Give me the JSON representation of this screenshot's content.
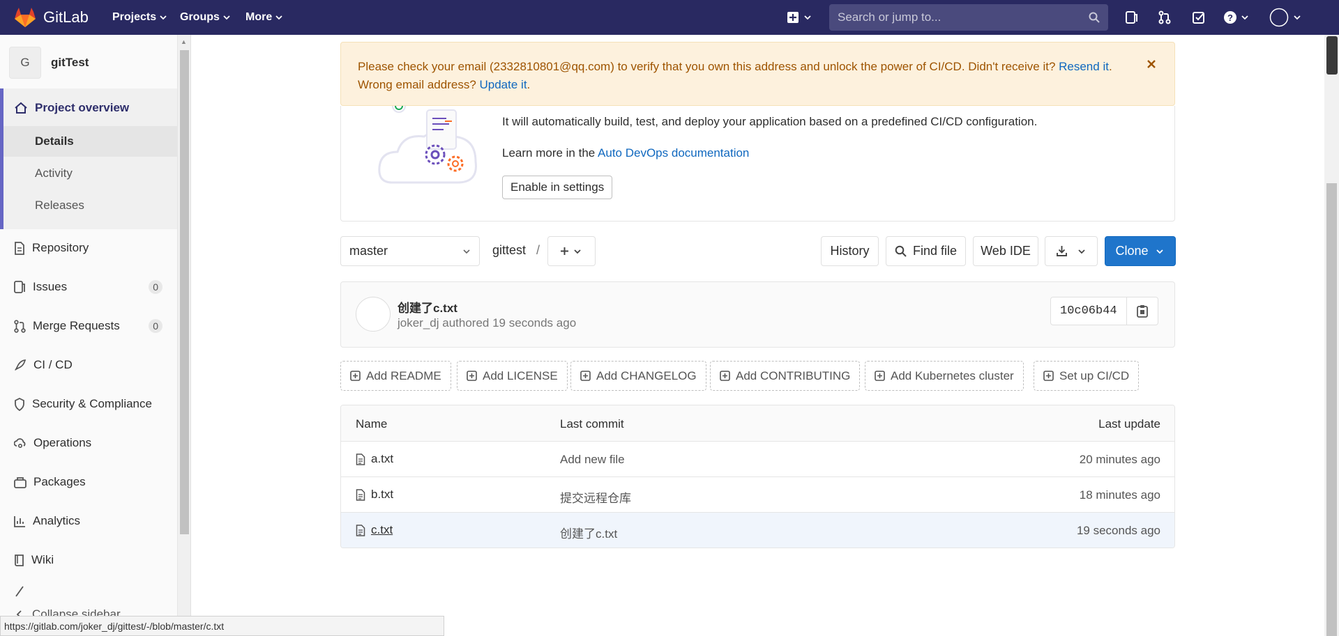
{
  "topnav": {
    "logo_text": "GitLab",
    "menus": [
      "Projects",
      "Groups",
      "More"
    ],
    "search_placeholder": "Search or jump to..."
  },
  "sidebar": {
    "project_initial": "G",
    "project_name": "gitTest",
    "overview_label": "Project overview",
    "overview_items": [
      "Details",
      "Activity",
      "Releases"
    ],
    "items": [
      {
        "label": "Repository",
        "icon": "document-icon"
      },
      {
        "label": "Issues",
        "icon": "issues-icon",
        "count": "0"
      },
      {
        "label": "Merge Requests",
        "icon": "merge-request-icon",
        "count": "0"
      },
      {
        "label": "CI / CD",
        "icon": "rocket-icon"
      },
      {
        "label": "Security & Compliance",
        "icon": "shield-icon"
      },
      {
        "label": "Operations",
        "icon": "cloud-gear-icon"
      },
      {
        "label": "Packages",
        "icon": "package-icon"
      },
      {
        "label": "Analytics",
        "icon": "chart-icon"
      },
      {
        "label": "Wiki",
        "icon": "book-icon"
      }
    ],
    "collapse_label": "Collapse sidebar"
  },
  "banner": {
    "text_before": "Please check your email (2332810801@qq.com) to verify that you own this address and unlock the power of CI/CD. Didn't receive it? ",
    "resend_link": "Resend it",
    "text_middle": ". Wrong email address? ",
    "update_link": "Update it",
    "text_end": "."
  },
  "devops": {
    "description": "It will automatically build, test, and deploy your application based on a predefined CI/CD configuration.",
    "learn_more": "Learn more in the ",
    "docs_link": "Auto DevOps documentation",
    "enable_button": "Enable in settings"
  },
  "repo_toolbar": {
    "branch": "master",
    "path_root": "gittest",
    "path_sep": "/",
    "history": "History",
    "find_file": "Find file",
    "web_ide": "Web IDE",
    "clone": "Clone"
  },
  "commit": {
    "title": "创建了c.txt",
    "author": "joker_dj",
    "meta_rest": " authored 19 seconds ago",
    "sha": "10c06b44"
  },
  "quick_actions": [
    "Add README",
    "Add LICENSE",
    "Add CHANGELOG",
    "Add CONTRIBUTING",
    "Add Kubernetes cluster",
    "Set up CI/CD"
  ],
  "files": {
    "headers": {
      "name": "Name",
      "last_commit": "Last commit",
      "last_update": "Last update"
    },
    "rows": [
      {
        "name": "a.txt",
        "commit": "Add new file",
        "updated": "20 minutes ago"
      },
      {
        "name": "b.txt",
        "commit": "提交远程仓库",
        "updated": "18 minutes ago"
      },
      {
        "name": "c.txt",
        "commit": "创建了c.txt",
        "updated": "19 seconds ago"
      }
    ]
  },
  "statusbar": {
    "url": "https://gitlab.com/joker_dj/gittest/-/blob/master/c.txt"
  },
  "colors": {
    "nav_bg": "#292961",
    "accent": "#6666c4",
    "primary_button": "#1f75cb",
    "link": "#1068bf",
    "warning_bg": "#fdf1dd"
  }
}
